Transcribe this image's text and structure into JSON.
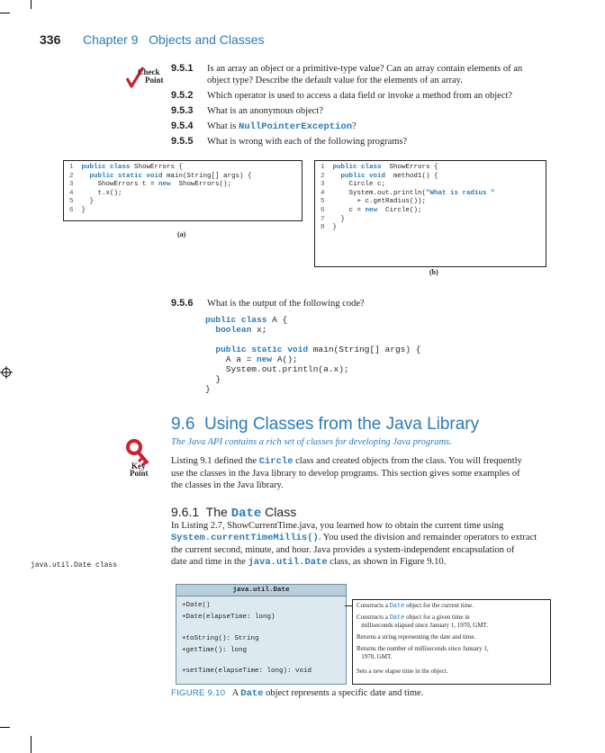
{
  "header": {
    "page_number": "336",
    "chapter": "Chapter 9   Objects and Classes"
  },
  "check_point": {
    "line1": "Check",
    "line2": "Point"
  },
  "questions": [
    {
      "num": "9.5.1",
      "text": "Is an array an object or a primitive-type value? Can an array contain elements of an",
      "text2": "object type? Describe the default value for the elements of an array."
    },
    {
      "num": "9.5.2",
      "text": "Which operator is used to access a data field or invoke a method from an object?"
    },
    {
      "num": "9.5.3",
      "text": "What is an anonymous object?"
    },
    {
      "num": "9.5.4",
      "text_pre": "What is ",
      "code": "NullPointerException",
      "text_post": "?"
    },
    {
      "num": "9.5.5",
      "text": "What is wrong with each of the following programs?"
    }
  ],
  "code_a": {
    "lines": [
      {
        "n": "1",
        "parts": [
          [
            "kw",
            "public class"
          ],
          [
            "",
            "ShowErrors {"
          ]
        ]
      },
      {
        "n": "2",
        "parts": [
          [
            "",
            "  "
          ],
          [
            "kw",
            "public static void"
          ],
          [
            "",
            "main(String[] args) {"
          ]
        ]
      },
      {
        "n": "3",
        "parts": [
          [
            "",
            "    ShowErrors t = "
          ],
          [
            "kw",
            "new"
          ],
          [
            "",
            " ShowErrors();"
          ]
        ]
      },
      {
        "n": "4",
        "parts": [
          [
            "",
            "    t.x();"
          ]
        ]
      },
      {
        "n": "5",
        "parts": [
          [
            "",
            "  }"
          ]
        ]
      },
      {
        "n": "6",
        "parts": [
          [
            "",
            "}"
          ]
        ]
      }
    ],
    "caption": "(a)"
  },
  "code_b": {
    "lines": [
      {
        "n": "1",
        "parts": [
          [
            "kw",
            "public class"
          ],
          [
            "",
            " ShowErrors {"
          ]
        ]
      },
      {
        "n": "2",
        "parts": [
          [
            "",
            "  "
          ],
          [
            "kw",
            "public void"
          ],
          [
            "",
            " method1() {"
          ]
        ]
      },
      {
        "n": "3",
        "parts": [
          [
            "",
            "    Circle c;"
          ]
        ]
      },
      {
        "n": "4",
        "parts": [
          [
            "",
            "    System.out.println("
          ],
          [
            "str",
            "\"What is radius \""
          ]
        ]
      },
      {
        "n": "5",
        "parts": [
          [
            "",
            "      + c.getRadius());"
          ]
        ]
      },
      {
        "n": "6",
        "parts": [
          [
            "",
            "    c = "
          ],
          [
            "kw",
            "new"
          ],
          [
            "",
            " Circle();"
          ]
        ]
      },
      {
        "n": "7",
        "parts": [
          [
            "",
            "  }"
          ]
        ]
      },
      {
        "n": "8",
        "parts": [
          [
            "",
            "}"
          ]
        ]
      }
    ],
    "caption": "(b)"
  },
  "q956": {
    "num": "9.5.6",
    "text": "What is the output of the following code?",
    "code": [
      [
        [
          "kw",
          "public class"
        ],
        [
          "",
          " A {"
        ]
      ],
      [
        [
          "",
          "  "
        ],
        [
          "kw",
          "boolean"
        ],
        [
          "",
          " x;"
        ]
      ],
      [
        [
          "",
          ""
        ]
      ],
      [
        [
          "",
          "  "
        ],
        [
          "kw",
          "public static void"
        ],
        [
          "",
          " main(String[] args) {"
        ]
      ],
      [
        [
          "",
          "    A a = "
        ],
        [
          "kw",
          "new"
        ],
        [
          "",
          " A();"
        ]
      ],
      [
        [
          "",
          "    System.out.println(a.x);"
        ]
      ],
      [
        [
          "",
          "  }"
        ]
      ],
      [
        [
          "",
          "}"
        ]
      ]
    ]
  },
  "section": {
    "title": "9.6  Using Classes from the Java Library",
    "subtitle": "The Java API contains a rich set of classes for developing Java programs.",
    "key_point": {
      "line1": "Key",
      "line2": "Point"
    },
    "para1_l1_pre": "Listing 9.1 defined the ",
    "para1_code": "Circle",
    "para1_l1_post": " class and created objects from the class. You will frequently",
    "para1_l2": "use the classes in the Java library to develop programs. This section gives some examples of",
    "para1_l3": "the classes in the Java library."
  },
  "subsection": {
    "title_pre": "9.6.1  The ",
    "title_code": "Date",
    "title_post": " Class",
    "l1": "In Listing 2.7, ShowCurrentTime.java, you learned how to obtain the current time using",
    "l2_code": "System.currentTimeMillis()",
    "l2_post": ". You used the division and remainder operators to extract",
    "l3": "the current second, minute, and hour. Java provides a system-independent encapsulation of",
    "l4_pre": "date and time in the ",
    "l4_code": "java.util.Date",
    "l4_post": " class, as shown in Figure 9.10.",
    "margin_note": "java.util.Date class"
  },
  "uml": {
    "class_name": "java.util.Date",
    "members": [
      "+Date()",
      "+Date(elapseTime: long)",
      "",
      "+toString(): String",
      "+getTime(): long",
      "",
      "+setTime(elapseTime: long): void"
    ],
    "descriptions": [
      [
        "Constructs a ",
        "Date",
        " object for the current time."
      ],
      [
        "Constructs a ",
        "Date",
        " object for a given time in"
      ],
      [
        "   milliseconds elapsed since January 1, 1970, GMT.",
        "",
        ""
      ],
      [
        "Returns a string representing the date and time.",
        "",
        ""
      ],
      [
        "Returns the number of milliseconds since January 1,",
        "",
        ""
      ],
      [
        "   1970, GMT.",
        "",
        ""
      ],
      [
        "Sets a new elapse time in the object.",
        "",
        ""
      ]
    ]
  },
  "figure": {
    "label": "FIGURE 9.10",
    "text_pre": "A ",
    "code": "Date",
    "text_post": " object represents a specific date and time."
  },
  "colors": {
    "accent": "#2a7cb8",
    "check_red": "#c8232c",
    "uml_fill": "#dde9f0"
  }
}
